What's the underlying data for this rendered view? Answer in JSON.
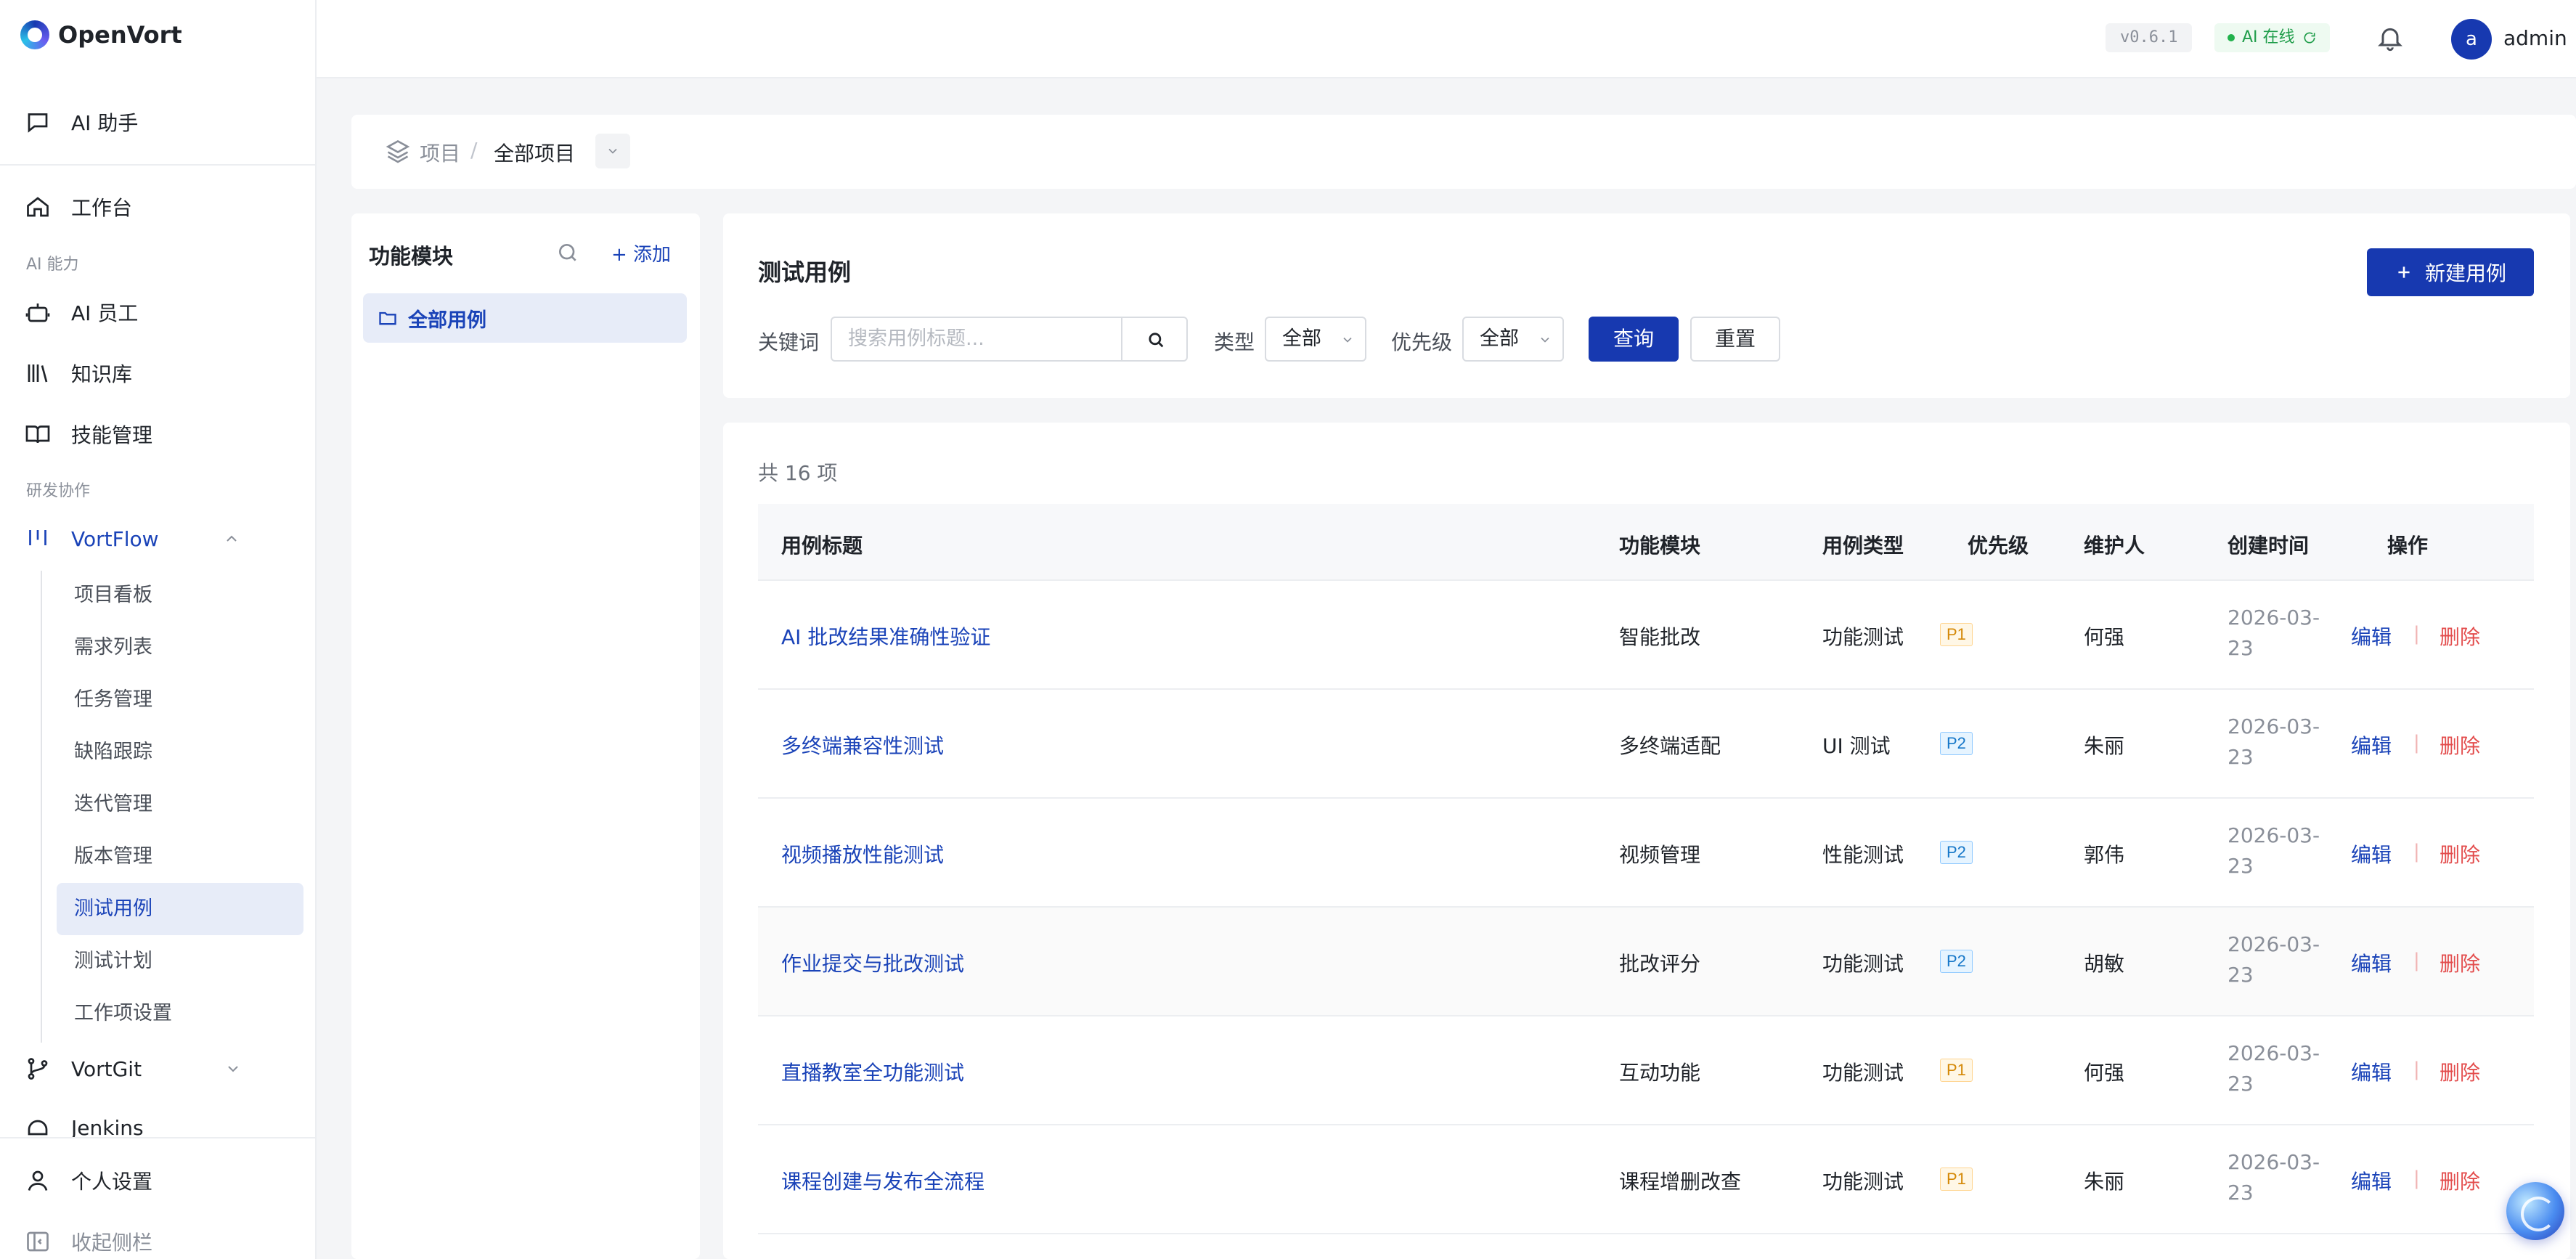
{
  "sidebar": {
    "logo": "OpenVort",
    "ai_assistant": "AI 助手",
    "workbench": "工作台",
    "group_ai": "AI 能力",
    "ai_staff": "AI 员工",
    "knowledge": "知识库",
    "skills": "技能管理",
    "group_dev": "研发协作",
    "vortflow": "VortFlow",
    "vortflow_items": [
      "项目看板",
      "需求列表",
      "任务管理",
      "缺陷跟踪",
      "迭代管理",
      "版本管理",
      "测试用例",
      "测试计划",
      "工作项设置"
    ],
    "vortgit": "VortGit",
    "jenkins": "Jenkins",
    "personal": "个人设置",
    "collapse": "收起侧栏"
  },
  "topbar": {
    "version": "v0.6.1",
    "ai_status": "AI 在线",
    "avatar_letter": "a",
    "username": "admin"
  },
  "breadcrumb": {
    "root": "项目",
    "separator": "/",
    "current": "全部项目"
  },
  "module_panel": {
    "title": "功能模块",
    "add": "+ 添加",
    "all_item": "全部用例"
  },
  "filters": {
    "title": "测试用例",
    "new_button": "新建用例",
    "keyword_label": "关键词",
    "keyword_placeholder": "搜索用例标题...",
    "type_label": "类型",
    "type_value": "全部",
    "priority_label": "优先级",
    "priority_value": "全部",
    "query": "查询",
    "reset": "重置"
  },
  "table": {
    "count": "共 16 项",
    "headers": [
      "用例标题",
      "功能模块",
      "用例类型",
      "优先级",
      "维护人",
      "创建时间",
      "操作"
    ],
    "edit": "编辑",
    "op_separator": "|",
    "delete": "删除",
    "rows": [
      {
        "title": "AI 批改结果准确性验证",
        "module": "智能批改",
        "type": "功能测试",
        "priority": "P1",
        "owner": "何强",
        "created": "2026-03-23"
      },
      {
        "title": "多终端兼容性测试",
        "module": "多终端适配",
        "type": "UI 测试",
        "priority": "P2",
        "owner": "朱丽",
        "created": "2026-03-23"
      },
      {
        "title": "视频播放性能测试",
        "module": "视频管理",
        "type": "性能测试",
        "priority": "P2",
        "owner": "郭伟",
        "created": "2026-03-23"
      },
      {
        "title": "作业提交与批改测试",
        "module": "批改评分",
        "type": "功能测试",
        "priority": "P2",
        "owner": "胡敏",
        "created": "2026-03-23"
      },
      {
        "title": "直播教室全功能测试",
        "module": "互动功能",
        "type": "功能测试",
        "priority": "P1",
        "owner": "何强",
        "created": "2026-03-23"
      },
      {
        "title": "课程创建与发布全流程",
        "module": "课程增删改查",
        "type": "功能测试",
        "priority": "P1",
        "owner": "朱丽",
        "created": "2026-03-23"
      }
    ]
  },
  "colors": {
    "primary": "#1739b0",
    "link": "#1a43b8",
    "danger": "#e34d4d",
    "p1": "#d48806",
    "p2": "#1677c8",
    "online": "#1f9d4a"
  }
}
